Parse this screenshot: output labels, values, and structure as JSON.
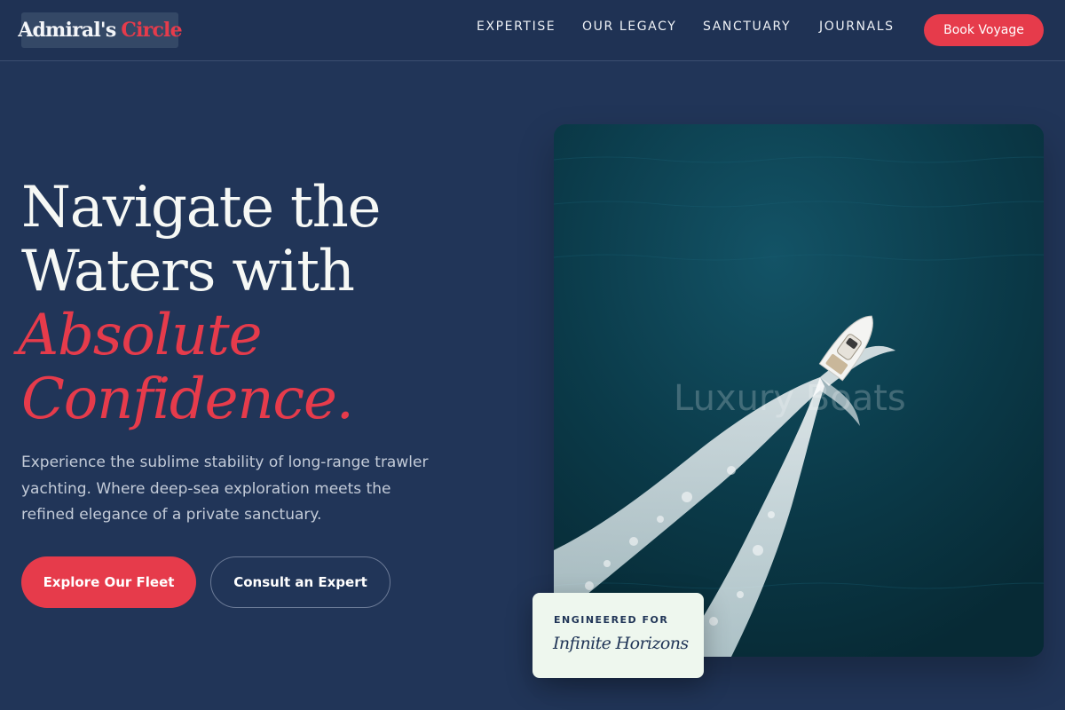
{
  "header": {
    "logo_word1": "Admiral's",
    "logo_word2": "Circle",
    "nav": [
      "EXPERTISE",
      "OUR LEGACY",
      "SANCTUARY",
      "JOURNALS"
    ],
    "book_label": "Book Voyage"
  },
  "hero": {
    "line1": "Navigate the",
    "line2": "Waters with",
    "line3": "Absolute",
    "line4": "Confidence.",
    "description": "Experience the sublime stability of long-range trawler yachting. Where deep-sea exploration meets the refined elegance of a private sanctuary.",
    "primary_cta": "Explore Our Fleet",
    "secondary_cta": "Consult an Expert"
  },
  "media": {
    "image_alt_text": "Luxury Boats"
  },
  "badge": {
    "kicker": "ENGINEERED FOR",
    "tagline": "Infinite Horizons"
  },
  "colors": {
    "background": "#213558",
    "accent": "#e63b4b",
    "card": "#eef7ee"
  }
}
